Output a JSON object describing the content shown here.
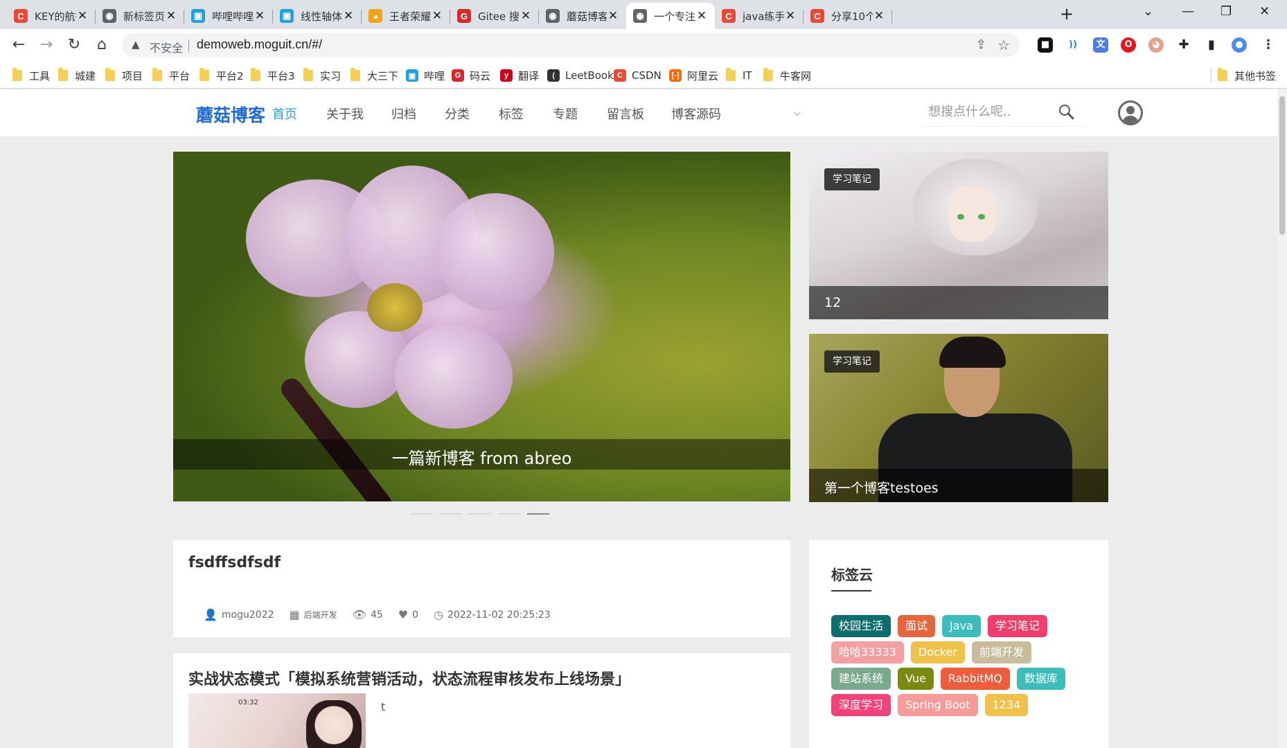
{
  "browser": {
    "tabs": [
      {
        "title": "KEY的航行",
        "icon_color": "#e84a35",
        "icon": "C"
      },
      {
        "title": "新标签页",
        "icon_color": "#5f6368",
        "icon": "◉"
      },
      {
        "title": "哔哩哔哩（",
        "icon_color": "#20a0e0",
        "icon": "▣"
      },
      {
        "title": "线性轴体运",
        "icon_color": "#20a0e0",
        "icon": "▣"
      },
      {
        "title": "王者荣耀",
        "icon_color": "#f4a21c",
        "icon": "◕"
      },
      {
        "title": "Gitee 搜索",
        "icon_color": "#d7292b",
        "icon": "G"
      },
      {
        "title": "蘑菇博客",
        "icon_color": "#5f6368",
        "icon": "◉"
      },
      {
        "title": "一个专注于",
        "icon_color": "#5f6368",
        "icon": "◉"
      },
      {
        "title": "java练手项",
        "icon_color": "#e84a35",
        "icon": "C"
      },
      {
        "title": "分享10个",
        "icon_color": "#e84a35",
        "icon": "C"
      }
    ],
    "active_tab_index": 7,
    "address": {
      "security_label": "不安全",
      "url": "demoweb.moguit.cn/#/"
    },
    "bookmarks": [
      {
        "label": "工具",
        "type": "folder"
      },
      {
        "label": "城建",
        "type": "folder"
      },
      {
        "label": "项目",
        "type": "folder"
      },
      {
        "label": "平台",
        "type": "folder"
      },
      {
        "label": "平台2",
        "type": "folder"
      },
      {
        "label": "平台3",
        "type": "folder"
      },
      {
        "label": "实习",
        "type": "folder"
      },
      {
        "label": "大三下",
        "type": "folder"
      },
      {
        "label": "哔哩",
        "type": "site",
        "color": "#20a0e0",
        "icon": "▣"
      },
      {
        "label": "码云",
        "type": "site",
        "color": "#d7292b",
        "icon": "G"
      },
      {
        "label": "翻译",
        "type": "site",
        "color": "#d0021b",
        "icon": "y"
      },
      {
        "label": "LeetBook",
        "type": "site",
        "color": "#333333",
        "icon": "⟨"
      },
      {
        "label": "CSDN",
        "type": "site",
        "color": "#e84a35",
        "icon": "C"
      },
      {
        "label": "阿里云",
        "type": "site",
        "color": "#ff6a00",
        "icon": "[-]"
      },
      {
        "label": "IT",
        "type": "folder"
      },
      {
        "label": "牛客网",
        "type": "folder"
      }
    ],
    "other_bookmarks": "其他书签"
  },
  "site": {
    "logo": "蘑菇博客",
    "nav": [
      "首页",
      "关于我",
      "归档",
      "分类",
      "标签",
      "专题",
      "留言板",
      "博客源码"
    ],
    "active_nav": 0,
    "search_placeholder": "想搜点什么呢.."
  },
  "hero": {
    "caption": "一篇新博客 from abreo",
    "slides": 5,
    "active_slide": 4
  },
  "side_cards": [
    {
      "tag": "学习笔记",
      "caption": "12"
    },
    {
      "tag": "学习笔记",
      "caption": "第一个博客testoes"
    }
  ],
  "posts": [
    {
      "title": "fsdffsdfsdf",
      "author": "mogu2022",
      "category": "后端开发",
      "views": "45",
      "likes": "0",
      "date": "2022-11-02 20:25:23"
    },
    {
      "title": "实战状态模式「模拟系统营销活动，状态流程审核发布上线场景」",
      "summary": "t",
      "thumb_time": "03:32"
    }
  ],
  "tag_cloud": {
    "title": "标签云",
    "tags": [
      {
        "label": "校园生活",
        "color": "#0e6e6e"
      },
      {
        "label": "面试",
        "color": "#e5653c"
      },
      {
        "label": "Java",
        "color": "#3dbcbc"
      },
      {
        "label": "学习笔记",
        "color": "#f03e6c"
      },
      {
        "label": "哈哈33333",
        "color": "#f4a0a0"
      },
      {
        "label": "Docker",
        "color": "#f0c24a"
      },
      {
        "label": "前端开发",
        "color": "#c8bc9a"
      },
      {
        "label": "建站系统",
        "color": "#7aaa8e"
      },
      {
        "label": "Vue",
        "color": "#7a8a0e"
      },
      {
        "label": "RabbitMQ",
        "color": "#ef5c3c"
      },
      {
        "label": "数据库",
        "color": "#3dbcbc"
      },
      {
        "label": "深度学习",
        "color": "#f5417a"
      },
      {
        "label": "Spring Boot",
        "color": "#f69a9a"
      },
      {
        "label": "1234",
        "color": "#f0c24a"
      }
    ]
  }
}
